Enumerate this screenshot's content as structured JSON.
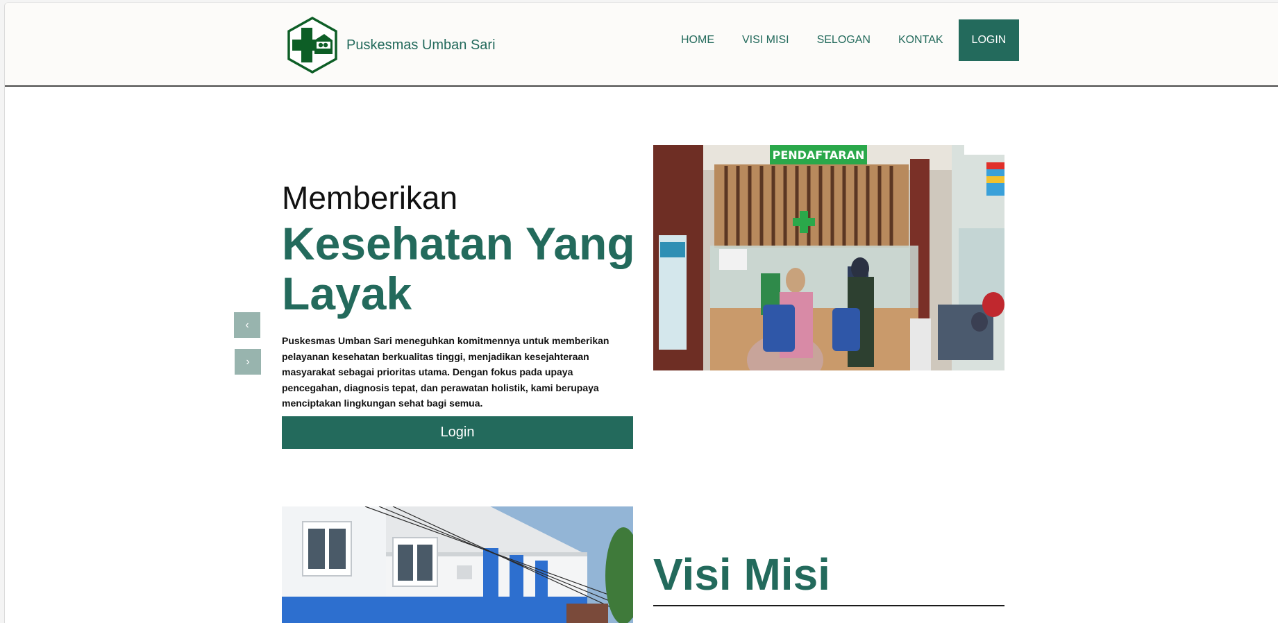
{
  "brand": {
    "name": "Puskesmas Umban Sari"
  },
  "nav": {
    "items": [
      "HOME",
      "VISI MISI",
      "SELOGAN",
      "KONTAK"
    ],
    "login_label": "LOGIN"
  },
  "hero": {
    "line1": "Memberikan",
    "line2": "Kesehatan Yang Layak",
    "description": "Puskesmas Umban Sari meneguhkan komitmennya untuk memberikan pelayanan kesehatan berkualitas tinggi, menjadikan kesejahteraan masyarakat sebagai prioritas utama. Dengan fokus pada upaya pencegahan, diagnosis tepat, dan perawatan holistik, kami berupaya menciptakan lingkungan sehat bagi semua.",
    "button_label": "Login",
    "image_sign": "PENDAFTARAN"
  },
  "carousel": {
    "prev_icon": "‹",
    "next_icon": "›"
  },
  "visi": {
    "title": "Visi Misi"
  },
  "colors": {
    "accent": "#236a5c",
    "arrow_bg": "#98b4ae",
    "navbar_bg": "#fcfbf9"
  }
}
